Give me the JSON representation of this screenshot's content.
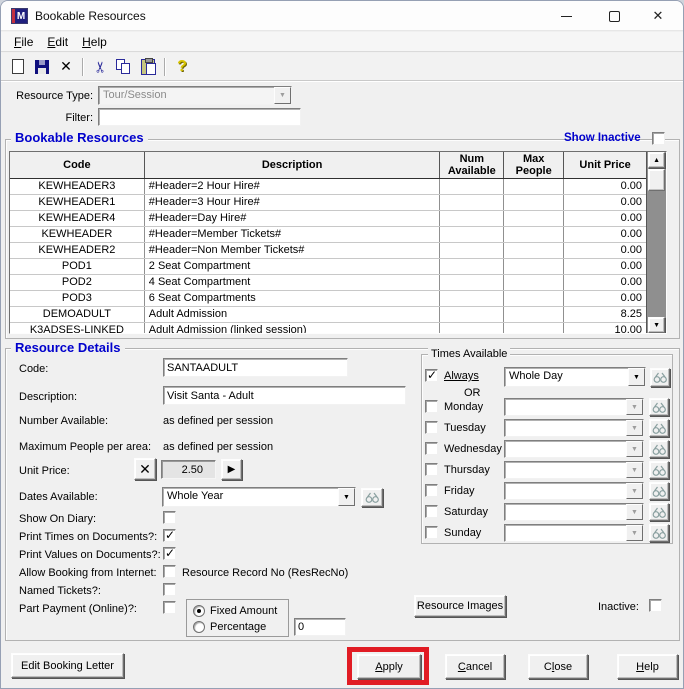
{
  "window": {
    "title": "Bookable Resources",
    "icon_letter": "M"
  },
  "menu": {
    "items": [
      {
        "label": "File",
        "u": 0
      },
      {
        "label": "Edit",
        "u": 0
      },
      {
        "label": "Help",
        "u": 0
      }
    ]
  },
  "toolbar": {
    "buttons": [
      "new-document",
      "save",
      "delete",
      "cut",
      "copy",
      "paste",
      "help"
    ]
  },
  "filters": {
    "resource_type_label": "Resource Type:",
    "resource_type_value": "Tour/Session",
    "filter_label": "Filter:",
    "filter_value": ""
  },
  "resources_panel": {
    "title": "Bookable Resources",
    "show_inactive_label": "Show Inactive",
    "show_inactive_checked": false,
    "table": {
      "columns": [
        "Code",
        "Description",
        "Num Available",
        "Max People",
        "Unit Price"
      ],
      "rows": [
        {
          "code": "KEWHEADER3",
          "description": "#Header=2 Hour Hire#",
          "num_available": "",
          "max_people": "",
          "unit_price": "0.00"
        },
        {
          "code": "KEWHEADER1",
          "description": "#Header=3 Hour Hire#",
          "num_available": "",
          "max_people": "",
          "unit_price": "0.00"
        },
        {
          "code": "KEWHEADER4",
          "description": "#Header=Day Hire#",
          "num_available": "",
          "max_people": "",
          "unit_price": "0.00"
        },
        {
          "code": "KEWHEADER",
          "description": "#Header=Member Tickets#",
          "num_available": "",
          "max_people": "",
          "unit_price": "0.00"
        },
        {
          "code": "KEWHEADER2",
          "description": "#Header=Non Member Tickets#",
          "num_available": "",
          "max_people": "",
          "unit_price": "0.00"
        },
        {
          "code": "POD1",
          "description": "2 Seat Compartment",
          "num_available": "",
          "max_people": "",
          "unit_price": "0.00"
        },
        {
          "code": "POD2",
          "description": "4 Seat Compartment",
          "num_available": "",
          "max_people": "",
          "unit_price": "0.00"
        },
        {
          "code": "POD3",
          "description": "6 Seat Compartments",
          "num_available": "",
          "max_people": "",
          "unit_price": "0.00"
        },
        {
          "code": "DEMOADULT",
          "description": "Adult Admission",
          "num_available": "",
          "max_people": "",
          "unit_price": "8.25"
        },
        {
          "code": "K3ADSES-LINKED",
          "description": "Adult Admission (linked session)",
          "num_available": "",
          "max_people": "",
          "unit_price": "10.00"
        }
      ]
    }
  },
  "details_panel": {
    "title": "Resource Details",
    "fields": {
      "code": {
        "label": "Code:",
        "value": "SANTAADULT"
      },
      "description": {
        "label": "Description:",
        "value": "Visit Santa - Adult"
      },
      "number_available": {
        "label": "Number Available:",
        "value": "as defined per session"
      },
      "max_people": {
        "label": "Maximum People per area:",
        "value": "as defined per session"
      },
      "unit_price": {
        "label": "Unit Price:",
        "value": "2.50"
      },
      "dates_available": {
        "label": "Dates Available:",
        "value": "Whole Year"
      },
      "show_on_diary": {
        "label": "Show On Diary:",
        "checked": false
      },
      "print_times": {
        "label": "Print Times on Documents?:",
        "checked": true
      },
      "print_values": {
        "label": "Print Values on Documents?:",
        "checked": true
      },
      "allow_booking": {
        "label": "Allow Booking from Internet:",
        "checked": false,
        "note": "Resource Record No (ResRecNo)"
      },
      "named_tickets": {
        "label": "Named Tickets?:",
        "checked": false
      },
      "part_payment": {
        "label": "Part Payment (Online)?:",
        "checked": false,
        "options": {
          "fixed": {
            "label": "Fixed Amount",
            "selected": true
          },
          "percentage": {
            "label": "Percentage",
            "selected": false
          },
          "amount": "0"
        }
      }
    },
    "times_available": {
      "title": "Times Available",
      "always": {
        "label": "Always",
        "checked": true,
        "value": "Whole Day"
      },
      "or_label": "OR",
      "days": [
        {
          "label": "Monday",
          "checked": false,
          "value": ""
        },
        {
          "label": "Tuesday",
          "checked": false,
          "value": ""
        },
        {
          "label": "Wednesday",
          "checked": false,
          "value": ""
        },
        {
          "label": "Thursday",
          "checked": false,
          "value": ""
        },
        {
          "label": "Friday",
          "checked": false,
          "value": ""
        },
        {
          "label": "Saturday",
          "checked": false,
          "value": ""
        },
        {
          "label": "Sunday",
          "checked": false,
          "value": ""
        }
      ]
    },
    "resource_images_button": "Resource Images",
    "inactive": {
      "label": "Inactive:",
      "checked": false
    }
  },
  "footer": {
    "edit_booking_letter": {
      "label": "Edit Booking Letter"
    },
    "apply": {
      "label": "Apply",
      "u": 0
    },
    "cancel": {
      "label": "Cancel",
      "u": 0
    },
    "close": {
      "label": "Close",
      "u": 1
    },
    "help": {
      "label": "Help",
      "u": 0
    }
  },
  "annotation": {
    "color": "#e11c24",
    "target": "apply-button"
  }
}
